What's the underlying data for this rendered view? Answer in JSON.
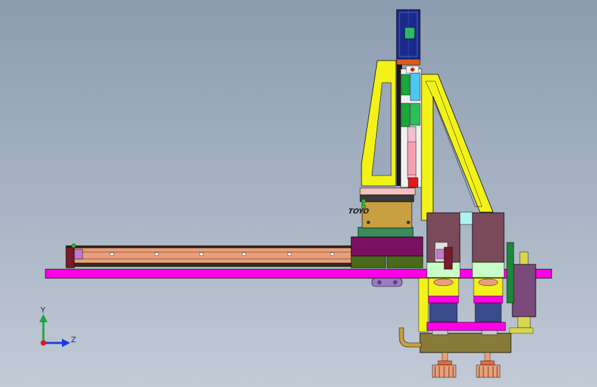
{
  "viewport": {
    "type": "CAD 3D viewport",
    "background": "gradient-blue-gray"
  },
  "model": {
    "logo_text": "TOYO",
    "parts": [
      "base-plate",
      "linear-rail",
      "rail-carriage",
      "vertical-frame",
      "vertical-motor",
      "vertical-axis-module",
      "diagonal-brace",
      "gripper-cylinder-left",
      "gripper-cylinder-right",
      "side-motor",
      "gripper-head",
      "vacuum-cup-left",
      "vacuum-cup-right",
      "elbow-fitting"
    ]
  },
  "triad": {
    "y_label": "Y",
    "z_label": "Z",
    "x_marker": "red-dot"
  },
  "colors": {
    "magenta": "#ff00e6",
    "yellow": "#f2f21a",
    "copper": "#e8a07c",
    "olive": "#8a7a3a",
    "purple": "#7a1060",
    "mauve": "#7a4a5a",
    "navy": "#1a2a8a",
    "green": "#1aa83a",
    "gold": "#c8a040"
  }
}
